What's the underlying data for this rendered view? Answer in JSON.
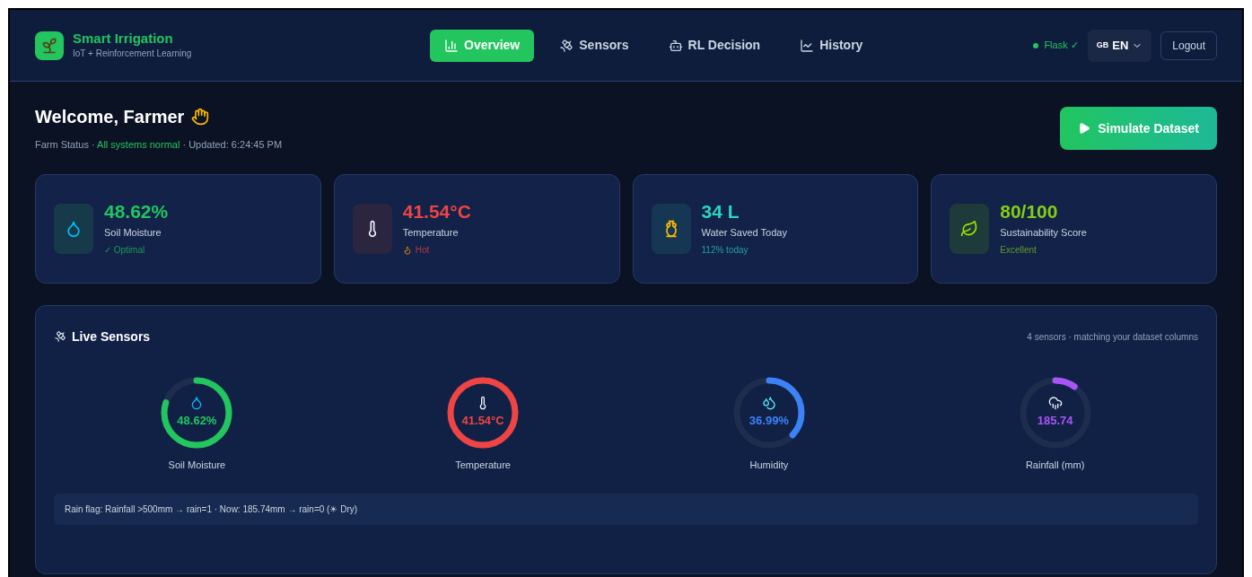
{
  "brand": {
    "title": "Smart Irrigation",
    "subtitle": "IoT + Reinforcement Learning"
  },
  "nav": [
    {
      "label": "Overview",
      "selected": true
    },
    {
      "label": "Sensors",
      "selected": false
    },
    {
      "label": "RL Decision",
      "selected": false
    },
    {
      "label": "History",
      "selected": false
    }
  ],
  "status": {
    "label": "Flask ✓",
    "online": true
  },
  "language": {
    "flag": "GB",
    "code": "EN"
  },
  "logout": "Logout",
  "welcome": {
    "title": "Welcome, Farmer",
    "prefix": "Farm Status · ",
    "state": "All systems normal",
    "suffix": " · Updated: 6:24:45 PM"
  },
  "simulate_button": "Simulate Dataset",
  "stats": [
    {
      "kind": "moisture",
      "value": "48.62%",
      "label": "Soil Moisture",
      "note": "✓ Optimal",
      "color": "#22c55e"
    },
    {
      "kind": "temperature",
      "value": "41.54°C",
      "label": "Temperature",
      "note": "Hot",
      "color": "#ef4444"
    },
    {
      "kind": "water",
      "value": "34 L",
      "label": "Water Saved Today",
      "note": "112% today",
      "color": "#2dd4bf"
    },
    {
      "kind": "score",
      "value": "80/100",
      "label": "Sustainability Score",
      "note": "Excellent",
      "color": "#84cc16"
    }
  ],
  "live_sensors": {
    "title": "Live Sensors",
    "subtitle": "4 sensors · matching your dataset columns",
    "gauges": [
      {
        "kind": "moisture",
        "value": "48.62%",
        "label": "Soil Moisture",
        "level": 0.8,
        "color": "#22c55e"
      },
      {
        "kind": "temperature",
        "value": "41.54°C",
        "label": "Temperature",
        "level": 1,
        "color": "#ef4444"
      },
      {
        "kind": "humidity",
        "value": "36.99%",
        "label": "Humidity",
        "level": 0.37,
        "color": "#3b82f6"
      },
      {
        "kind": "rainfall",
        "value": "185.74",
        "label": "Rainfall (mm)",
        "level": 0.1,
        "color": "#a855f7"
      }
    ],
    "rain_flag": "Rain flag: Rainfall >500mm → rain=1 · Now: 185.74mm → rain=0 (☀ Dry)"
  }
}
